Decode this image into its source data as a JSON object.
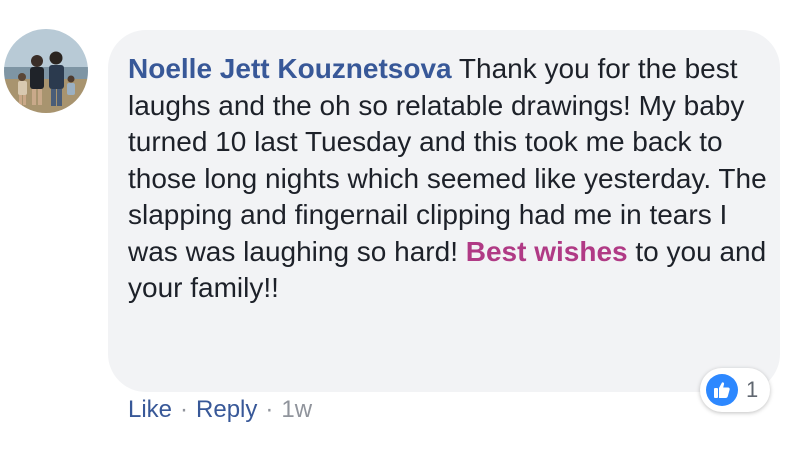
{
  "comment": {
    "author": "Noelle Jett Kouznetsova",
    "text_before": " Thank you for the best laughs and the oh so relatable drawings! My baby turned 10 last Tuesday and this took me back to those long nights which seemed like yesterday. The slapping and fingernail clipping had me in tears I was was laughing so hard! ",
    "mention": "Best wishes",
    "text_after": " to you and your family!!"
  },
  "reactions": {
    "icon": "thumbs-up-icon",
    "count": "1"
  },
  "actions": {
    "like_label": "Like",
    "separator": "·",
    "reply_label": "Reply",
    "timestamp": "1w"
  },
  "colors": {
    "author": "#385898",
    "mention": "#b03a85",
    "bubble": "#f2f3f5",
    "like_badge": "#2d88ff"
  }
}
